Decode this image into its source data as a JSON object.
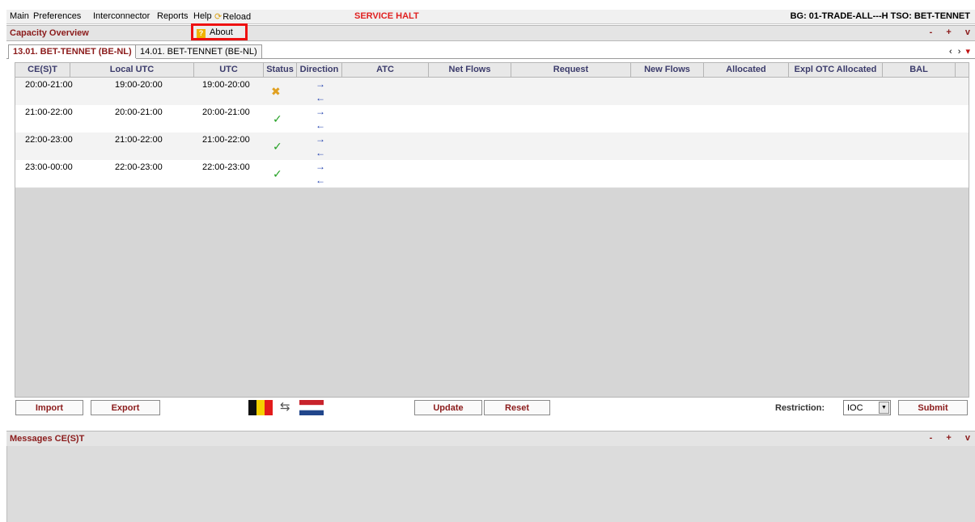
{
  "menu": {
    "main": "Main",
    "preferences": "Preferences",
    "interconnector": "Interconnector",
    "reports": "Reports",
    "help": "Help",
    "reload": "Reload",
    "service_halt": "SERVICE HALT",
    "bg_info": "BG: 01-TRADE-ALL---H  TSO: BET-TENNET"
  },
  "help_dropdown": {
    "about": "About"
  },
  "capacity_panel": {
    "title": "Capacity Overview",
    "controls": [
      "-",
      "+",
      "v"
    ]
  },
  "tabs": [
    {
      "label": "13.01. BET-TENNET (BE-NL)",
      "active": true
    },
    {
      "label": "14.01. BET-TENNET (BE-NL)",
      "active": false
    }
  ],
  "tab_nav": {
    "prev": "‹",
    "next": "›",
    "menu": "▾"
  },
  "columns": [
    "CE(S)T",
    "Local UTC",
    "UTC",
    "Status",
    "Direction",
    "ATC",
    "Net Flows",
    "Request",
    "New Flows",
    "Allocated",
    "Expl OTC Allocated",
    "BAL"
  ],
  "rows": [
    {
      "cest": "20:00-21:00",
      "local_utc": "19:00-20:00",
      "utc": "19:00-20:00",
      "status": "error",
      "status_icon": "✖",
      "dir_out": "→",
      "dir_in": "←"
    },
    {
      "cest": "21:00-22:00",
      "local_utc": "20:00-21:00",
      "utc": "20:00-21:00",
      "status": "ok",
      "status_icon": "✓",
      "dir_out": "→",
      "dir_in": "←"
    },
    {
      "cest": "22:00-23:00",
      "local_utc": "21:00-22:00",
      "utc": "21:00-22:00",
      "status": "ok",
      "status_icon": "✓",
      "dir_out": "→",
      "dir_in": "←"
    },
    {
      "cest": "23:00-00:00",
      "local_utc": "22:00-23:00",
      "utc": "22:00-23:00",
      "status": "ok",
      "status_icon": "✓",
      "dir_out": "→",
      "dir_in": "←"
    }
  ],
  "toolbar": {
    "import": "Import",
    "export": "Export",
    "swap": "⇆",
    "update": "Update",
    "reset": "Reset",
    "restriction_label": "Restriction:",
    "restriction_value": "IOC",
    "submit": "Submit"
  },
  "colors": {
    "brand_red": "#8b1b1b",
    "alert_red": "#e02020",
    "highlight_border": "#ee1111",
    "ok_green": "#22a022",
    "err_yellow": "#e0a020",
    "arrow_blue": "#1f3fae"
  },
  "messages_panel": {
    "title": "Messages CE(S)T",
    "controls": [
      "-",
      "+",
      "v"
    ]
  }
}
